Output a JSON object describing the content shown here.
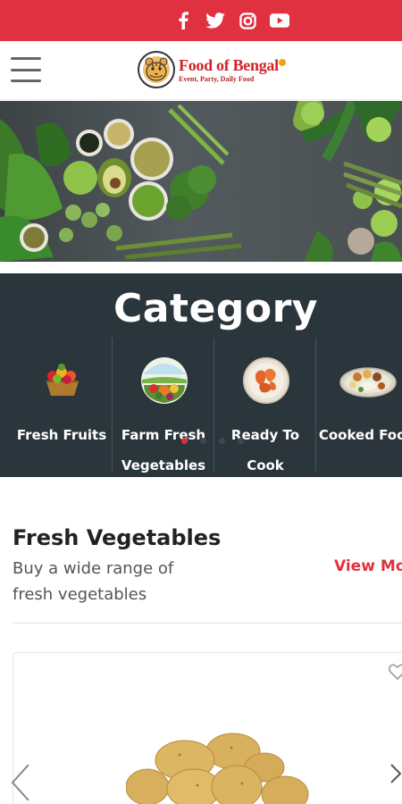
{
  "social": {
    "icons": [
      "facebook-icon",
      "twitter-icon",
      "instagram-icon",
      "youtube-icon"
    ]
  },
  "header": {
    "menu_icon": "hamburger-menu-icon",
    "logo": {
      "name": "Food of Bengal",
      "tagline": "Event, Party, Daily Food"
    }
  },
  "category": {
    "title": "Category",
    "items": [
      {
        "label": "Fresh Fruits",
        "icon": "fruit-basket-icon"
      },
      {
        "label": "Farm Fresh Vegetables",
        "icon": "vegetables-icon"
      },
      {
        "label": "Ready To Cook",
        "icon": "raw-meat-icon"
      },
      {
        "label": "Cooked Food",
        "icon": "food-platter-icon"
      }
    ],
    "active_dot": 0
  },
  "section": {
    "title": "Fresh Vegetables",
    "subtitle": "Buy a wide range of fresh vegetables",
    "view_more": "View More"
  },
  "product": {
    "image": "potatoes-image",
    "wishlist_icon": "heart-icon",
    "prev_icon": "chevron-left-icon",
    "next_icon": "chevron-right-icon"
  },
  "colors": {
    "brand_red": "#e03141",
    "category_bg": "#2a363b",
    "accent": "#e0303d"
  }
}
